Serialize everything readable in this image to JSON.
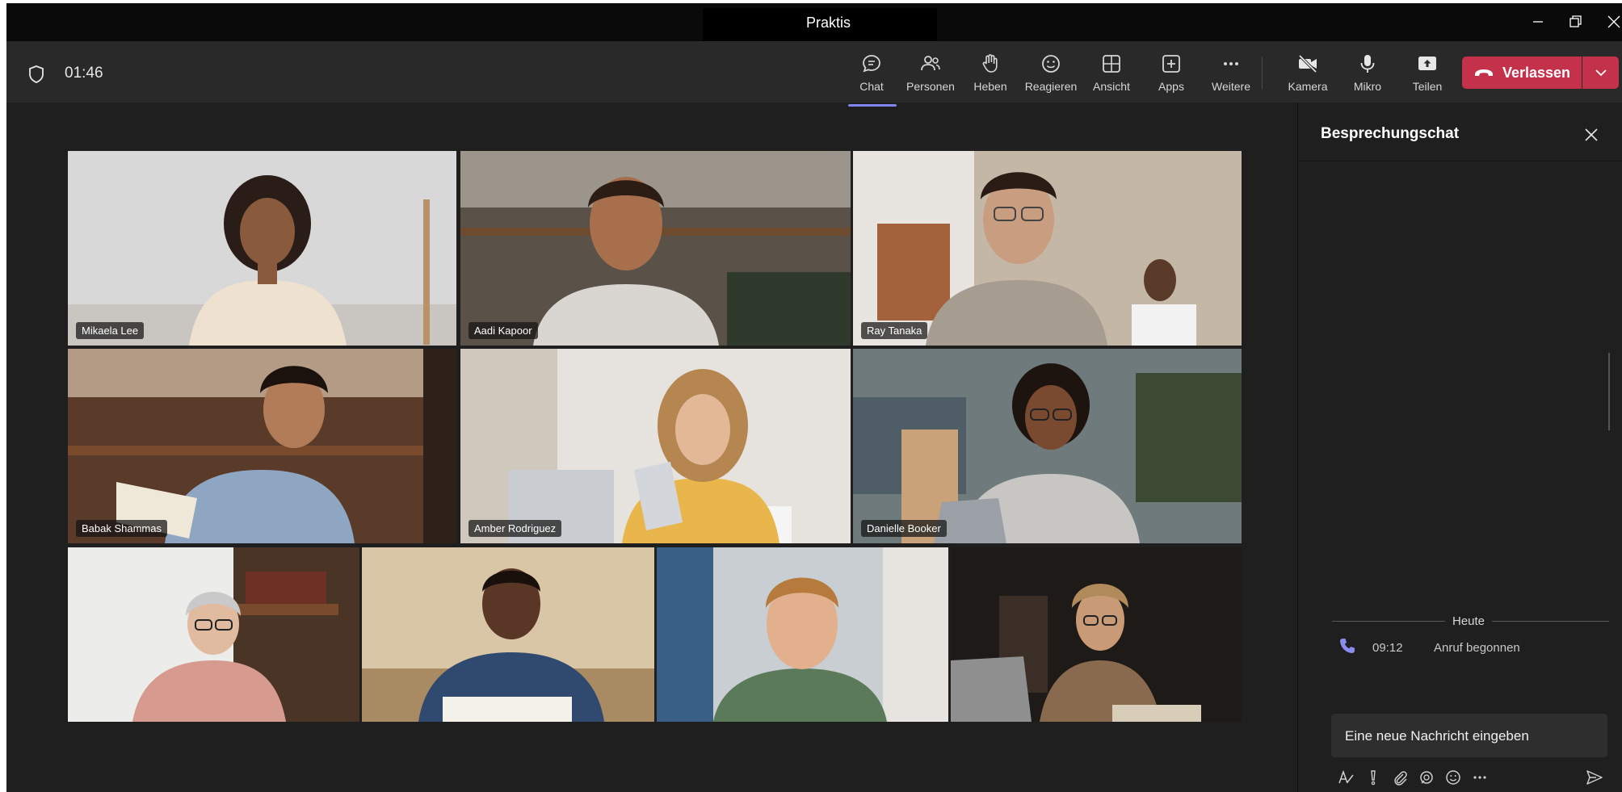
{
  "window": {
    "title": "Praktis"
  },
  "meeting": {
    "timer": "01:46"
  },
  "toolbar": {
    "chat": "Chat",
    "people": "Personen",
    "raise": "Heben",
    "react": "Reagieren",
    "view": "Ansicht",
    "apps": "Apps",
    "more": "Weitere",
    "camera": "Kamera",
    "mic": "Mikro",
    "share": "Teilen",
    "leave": "Verlassen"
  },
  "participants": [
    {
      "name": "Mikaela Lee"
    },
    {
      "name": "Aadi Kapoor"
    },
    {
      "name": "Ray Tanaka"
    },
    {
      "name": "Babak Shammas"
    },
    {
      "name": "Amber Rodriguez"
    },
    {
      "name": "Danielle Booker"
    },
    {
      "name": ""
    },
    {
      "name": ""
    },
    {
      "name": ""
    },
    {
      "name": ""
    }
  ],
  "chat": {
    "title": "Besprechungschat",
    "date_separator": "Heute",
    "events": [
      {
        "time": "09:12",
        "text": "Anruf begonnen"
      }
    ],
    "compose_placeholder": "Eine neue Nachricht eingeben"
  },
  "colors": {
    "accent": "#7f85f5",
    "leave": "#c4314b",
    "background": "#1f1f1f",
    "toolbar": "#292929"
  }
}
